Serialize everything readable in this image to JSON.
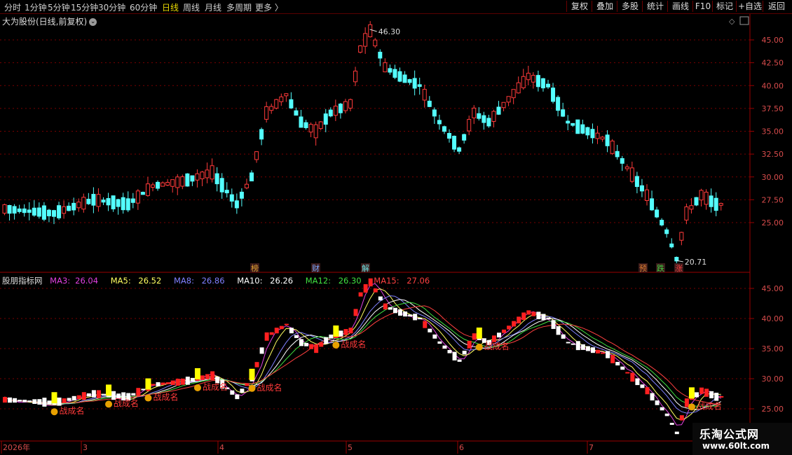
{
  "toolbar": {
    "periods": [
      "分时",
      "1分钟",
      "5分钟",
      "15分钟",
      "30分钟",
      "60分钟",
      "日线",
      "周线",
      "月线",
      "多周期",
      "更多 〉"
    ],
    "active_period": "日线",
    "right_buttons": [
      "复权",
      "叠加",
      "多股",
      "统计",
      "画线",
      "F10",
      "标记",
      "+自选",
      "返回"
    ]
  },
  "main_panel": {
    "title": "大为股份(日线,前复权)",
    "high_label": "46.30",
    "low_label": "20.71",
    "price_ticks": [
      "45.00",
      "42.50",
      "40.00",
      "37.50",
      "35.00",
      "32.50",
      "30.00",
      "27.50",
      "25.00"
    ],
    "markers": [
      {
        "text": "榜",
        "color": "#e0a030"
      },
      {
        "text": "财",
        "color": "#7aa8ff"
      },
      {
        "text": "解",
        "color": "#6ee0e0"
      },
      {
        "text": "预",
        "color": "#e08030"
      },
      {
        "text": "跌",
        "color": "#40d040"
      },
      {
        "text": "涨",
        "color": "#ff4040"
      }
    ]
  },
  "indicator_panel": {
    "name": "股朋指标网",
    "ma_values": [
      {
        "label": "MA3:",
        "value": "26.04",
        "color": "#e040e0"
      },
      {
        "label": "MA5:",
        "value": "26.52",
        "color": "#ffff60"
      },
      {
        "label": "MA8:",
        "value": "26.86",
        "color": "#8080ff"
      },
      {
        "label": "MA10:",
        "value": "26.26",
        "color": "#ffffff"
      },
      {
        "label": "MA12:",
        "value": "26.30",
        "color": "#40e040"
      },
      {
        "label": "MA15:",
        "value": "27.06",
        "color": "#ff4040"
      }
    ],
    "price_ticks": [
      "45.00",
      "40.00",
      "35.00",
      "30.00",
      "25.00"
    ],
    "signal_text": "战成名"
  },
  "dates": [
    "2026年",
    "3",
    "4",
    "5",
    "6",
    "7"
  ],
  "watermark": {
    "title": "乐淘公式网",
    "url": "www.60lt.com"
  },
  "colors": {
    "up": "#ff3a3a",
    "down": "#54ffff",
    "grid": "#7a0000",
    "bg": "#000000"
  }
}
